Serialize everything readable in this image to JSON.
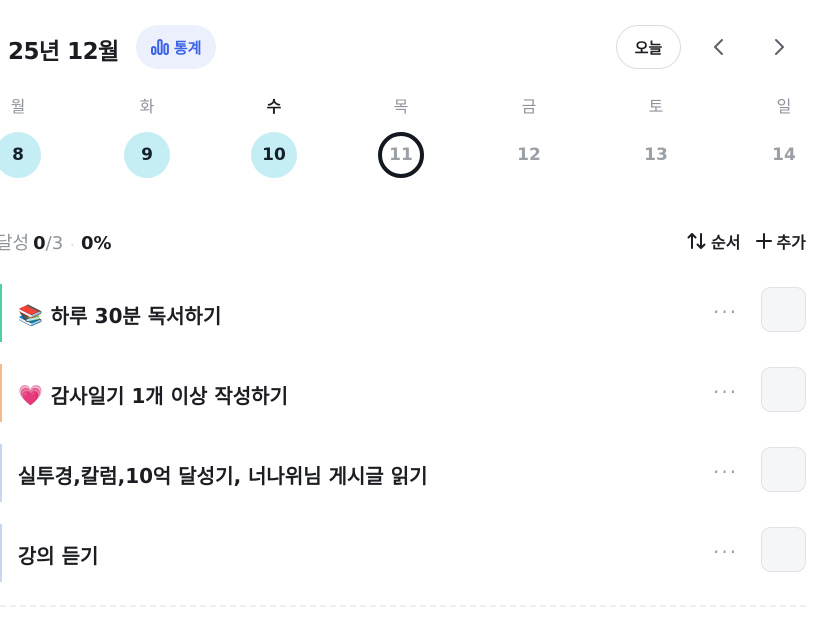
{
  "header": {
    "month_title": "25년 12월",
    "stats_label": "통계",
    "today_label": "오늘",
    "prev_icon": "chevron-left-icon",
    "next_icon": "chevron-right-icon"
  },
  "week": {
    "days": [
      "월",
      "화",
      "수",
      "목",
      "금",
      "토",
      "일"
    ],
    "dates": [
      "8",
      "9",
      "10",
      "11",
      "12",
      "13",
      "14"
    ],
    "completed": [
      true,
      true,
      true,
      false,
      false,
      false,
      false
    ],
    "today_index": 3
  },
  "summary": {
    "label": "달성",
    "done": "0",
    "total": "/3",
    "separator": "·",
    "percent": "0%",
    "sort_label": "순서",
    "add_label": "추가"
  },
  "habits": [
    {
      "emoji": "📚",
      "title": "하루 30분 독서하기",
      "accent": "#4ecfa5"
    },
    {
      "emoji": "💗",
      "title": "감사일기 1개 이상 작성하기",
      "accent": "#f7b98c"
    },
    {
      "emoji": "",
      "title": "실투경,칼럼,10억 달성기, 너나위님 게시글 읽기",
      "accent": "#c9d6ef"
    },
    {
      "emoji": "",
      "title": "강의 듣기",
      "accent": "#c9d6ef"
    }
  ],
  "more_glyph": "···",
  "colors": {
    "accent_blue": "#3a63e6",
    "completed_day": "#c5eef4",
    "today_ring": "#141820"
  }
}
